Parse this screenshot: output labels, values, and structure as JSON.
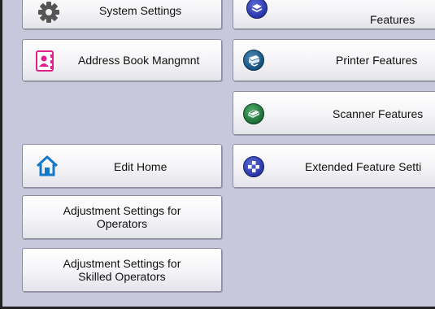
{
  "buttons": {
    "system_settings": "System Settings",
    "features": "Features",
    "address_book": "Address Book Mangmnt",
    "printer_features": "Printer Features",
    "scanner_features": "Scanner Features",
    "edit_home": "Edit Home",
    "extended_feature": "Extended Feature Setti",
    "adjust_operators": "Adjustment Settings for\nOperators",
    "adjust_skilled": "Adjustment Settings for\nSkilled Operators"
  },
  "icons": {
    "system_settings": "gear-icon",
    "features": "features-icon",
    "address_book": "address-book-icon",
    "printer_features": "printer-icon",
    "scanner_features": "scanner-icon",
    "edit_home": "home-icon",
    "extended_feature": "extended-feature-icon"
  },
  "colors": {
    "panel_background": "#c8c8dc",
    "address_book_icon": "#e0208c",
    "home_icon": "#1478c8"
  }
}
